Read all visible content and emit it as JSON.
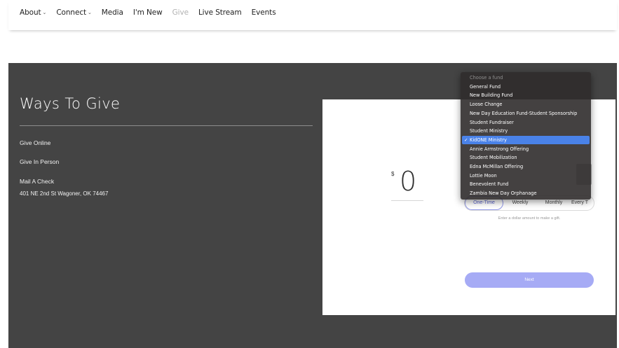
{
  "nav": {
    "items": [
      {
        "label": "About",
        "chevron": true,
        "active": false
      },
      {
        "label": "Connect",
        "chevron": true,
        "active": false
      },
      {
        "label": "Media",
        "chevron": false,
        "active": false
      },
      {
        "label": "I'm New",
        "chevron": false,
        "active": false
      },
      {
        "label": "Give",
        "chevron": false,
        "active": true
      },
      {
        "label": "Live Stream",
        "chevron": false,
        "active": false
      },
      {
        "label": "Events",
        "chevron": false,
        "active": false
      }
    ],
    "chevron_glyph": "⌄"
  },
  "page": {
    "title": "Ways To Give",
    "give_online": "Give Online",
    "give_in_person": "Give In Person",
    "mail_check": "Mail A Check",
    "address": "401 NE 2nd St Wagoner, OK 74467"
  },
  "widget": {
    "currency": "$",
    "amount": "0",
    "frequency": [
      "One-Time",
      "Weekly",
      "Monthly",
      "Every T"
    ],
    "hint": "Enter a dollar amount to make a gift.",
    "next_label": "Next"
  },
  "dropdown": {
    "placeholder": "Choose a fund",
    "check_glyph": "✓",
    "selected_index": 7,
    "options": [
      "General Fund",
      "New Building Fund",
      "Loose Change",
      "New Day Education Fund-Student Sponsorship",
      "Student Fundraiser",
      "Student Ministry",
      "KidONE Ministry",
      "Annie Armstrong Offering",
      "Student Mobilization",
      "Edna McMillan Offering",
      "Lottie Moon",
      "Benevolent Fund",
      "Zambia New Day Orphanage"
    ]
  },
  "colors": {
    "section_bg": "#444444",
    "accent": "#a6abf5",
    "dropdown_highlight": "#4a82e8"
  }
}
